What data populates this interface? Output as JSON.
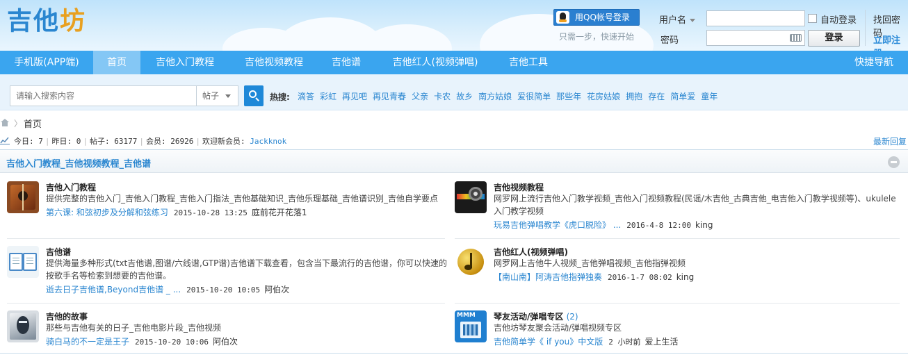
{
  "header": {
    "logo": [
      "吉",
      "他",
      "坊"
    ],
    "qq_login": "用QQ帐号登录",
    "qq_sub": "只需一步，快速开始",
    "username_label": "用户名",
    "password_label": "密码",
    "remember": "自动登录",
    "login_button": "登录",
    "forgot": "找回密码",
    "register": "立即注册"
  },
  "nav": {
    "items": [
      "手机版(APP端)",
      "首页",
      "吉他入门教程",
      "吉他视频教程",
      "吉他谱",
      "吉他红人(视频弹唱)",
      "吉他工具"
    ],
    "active": "首页",
    "shortcut": "快捷导航"
  },
  "search": {
    "placeholder": "请输入搜索内容",
    "type": "帖子",
    "hot_label": "热搜:",
    "hot": [
      "滴答",
      "彩虹",
      "再见吧",
      "再见青春",
      "父亲",
      "卡农",
      "故乡",
      "南方姑娘",
      "爱很简单",
      "那些年",
      "花房姑娘",
      "拥抱",
      "存在",
      "简单爱",
      "童年"
    ]
  },
  "breadcrumb": {
    "home": "首页"
  },
  "stats": {
    "today_label": "今日:",
    "today": "7",
    "yesterday_label": "昨日:",
    "yesterday": "0",
    "posts_label": "帖子:",
    "posts": "63177",
    "members_label": "会员:",
    "members": "26926",
    "welcome_label": "欢迎新会员:",
    "new_member": "Jackknok",
    "latest": "最新回复"
  },
  "box": {
    "title": "吉他入门教程_吉他视频教程_吉他谱",
    "forums": [
      {
        "title": "吉他入门教程",
        "count": "",
        "icon": "guitar-icon",
        "desc": "提供完整的吉他入门_吉他入门教程_吉他入门指法_吉他基础知识_吉他乐理基础_吉他谱识别_吉他自学要点",
        "last_link": "第六课: 和弦初步及分解和弦练习",
        "last_time": "2015-10-28 13:25",
        "last_user": "庭前花开花落1"
      },
      {
        "title": "吉他视频教程",
        "count": "",
        "icon": "video-reel-icon",
        "desc": "网罗网上流行吉他入门教学视频_吉他入门视频教程(民谣/木吉他_古典吉他_电吉他入门教学视频等)、ukulele入门教学视频",
        "last_link": "玩易吉他弹唱教学《虎口脱险》 ...",
        "last_time": "2016-4-8 12:00",
        "last_user": "king"
      },
      {
        "title": "吉他谱",
        "count": "",
        "icon": "book-icon",
        "desc": "提供海量多种形式(txt吉他谱,图谱/六线谱,GTP谱)吉他谱下载查看，包含当下最流行的吉他谱，你可以快速的按歌手名等检索到想要的吉他谱。",
        "last_link": "逝去日子吉他谱,Beyond吉他谱 _ ...",
        "last_time": "2015-10-20 10:05",
        "last_user": "阿伯次"
      },
      {
        "title": "吉他红人(视频弹唱)",
        "count": "",
        "icon": "music-note-icon",
        "desc": "网罗网上吉他牛人视频_吉他弹唱视频_吉他指弹视频",
        "last_link": "【南山南】阿涛吉他指弹独奏",
        "last_time": "2016-1-7 08:02",
        "last_user": "king"
      },
      {
        "title": "吉他的故事",
        "count": "",
        "icon": "portrait-icon",
        "desc": "那些与吉他有关的日子_吉他电影片段_吉他视频",
        "last_link": "骑白马的不一定是王子",
        "last_time": "2015-10-20 10:06",
        "last_user": "阿伯次"
      },
      {
        "title": "琴友活动/弹唱专区",
        "count": "(2)",
        "icon": "mmm-video-icon",
        "desc": "吉他坊琴友聚会活动/弹唱视频专区",
        "last_link": "吉他简单学《 if you》中文版",
        "last_time": "2 小时前",
        "last_user": "爱上生活"
      }
    ]
  }
}
